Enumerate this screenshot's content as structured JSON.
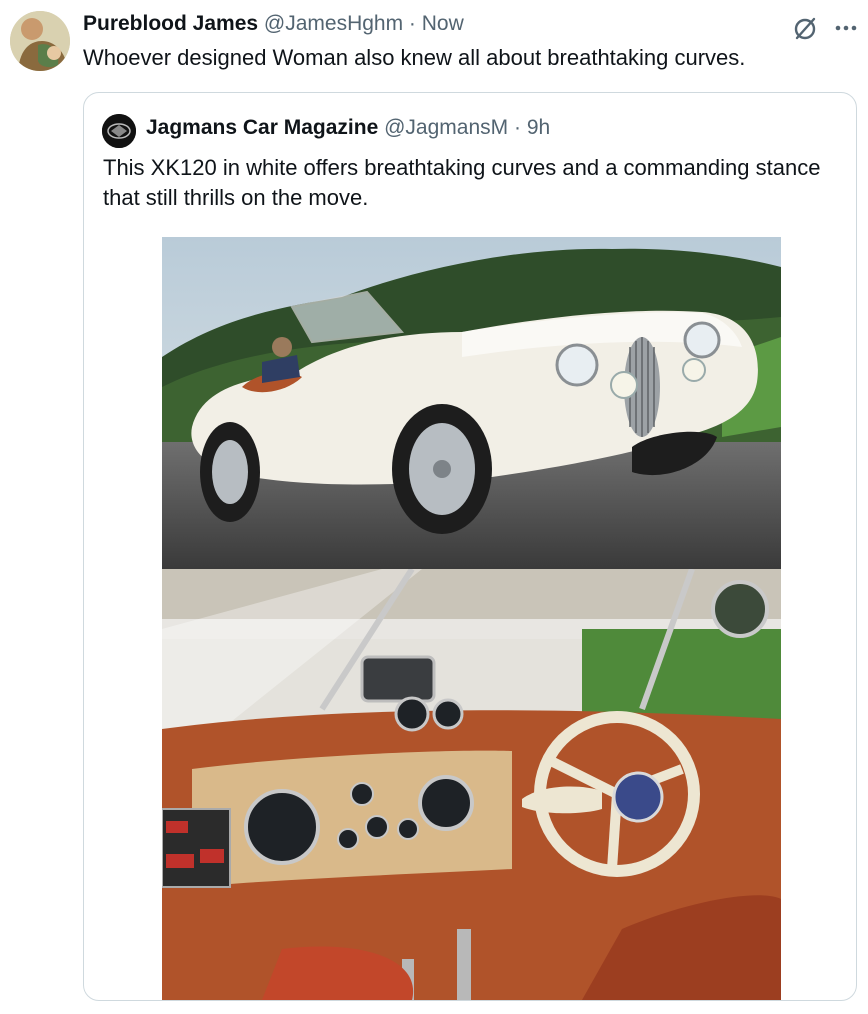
{
  "tweet": {
    "author_name": "Pureblood James",
    "handle": "@JamesHghm",
    "separator": " · ",
    "time": "Now",
    "text": "Whoever designed Woman also knew all about breathtaking curves.",
    "avatar_icon": "profile-avatar",
    "actions_icon": "more-options-icon"
  },
  "quoted": {
    "author_name": "Jagmans Car Magazine",
    "handle": "@JagmansM",
    "separator": " · ",
    "time": "9h",
    "text": "This XK120 in white offers breathtaking curves and a commanding stance that still thrills on the move."
  },
  "colors": {
    "car_body": "#f2efe6",
    "leather": "#b0532a",
    "dash_panel": "#d9b98a",
    "grass": "#4f8a3a"
  }
}
